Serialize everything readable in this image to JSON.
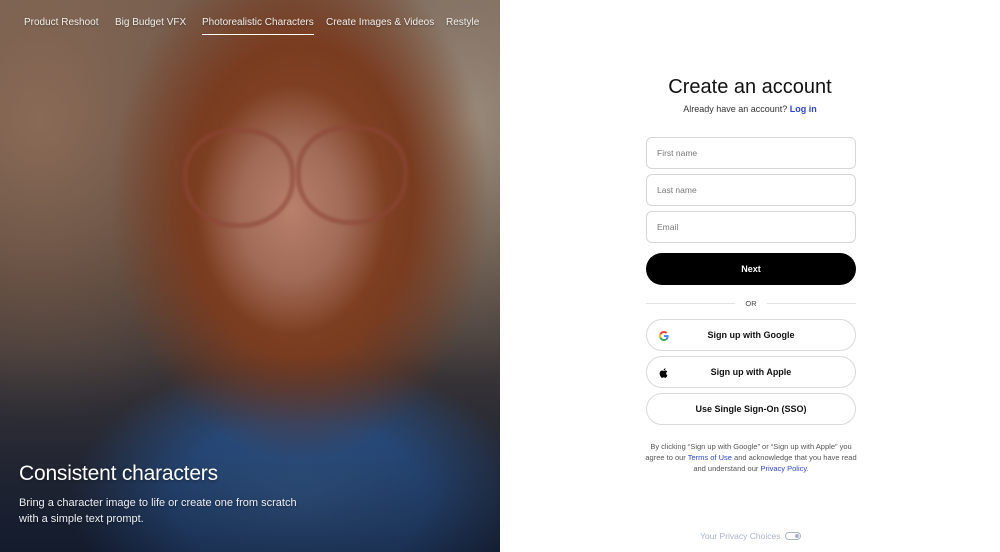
{
  "nav": {
    "items": [
      {
        "label": "Product Reshoot"
      },
      {
        "label": "Big Budget VFX"
      },
      {
        "label": "Photorealistic Characters",
        "active": true
      },
      {
        "label": "Create Images & Videos"
      },
      {
        "label": "Restyle"
      }
    ]
  },
  "hero": {
    "title": "Consistent characters",
    "subtitle": "Bring a character image to life or create one from scratch with a simple text prompt."
  },
  "form": {
    "title": "Create an account",
    "login_prompt": "Already have an account?",
    "login_link": "Log in",
    "first_name_placeholder": "First name",
    "last_name_placeholder": "Last name",
    "email_placeholder": "Email",
    "next_label": "Next",
    "or_label": "OR",
    "google_label": "Sign up with Google",
    "apple_label": "Sign up with Apple",
    "sso_label": "Use Single Sign-On (SSO)",
    "legal": {
      "part1": "By clicking “Sign up with Google” or “Sign up with Apple” you agree to our ",
      "terms_link": "Terms of Use",
      "part2": " and acknowledge that you have read and understand our ",
      "privacy_link": "Privacy Policy",
      "part3": "."
    },
    "privacy_choices": "Your Privacy Choices"
  },
  "colors": {
    "link": "#2c46c6",
    "primary_button": "#000000",
    "muted": "#a9b3c8"
  }
}
